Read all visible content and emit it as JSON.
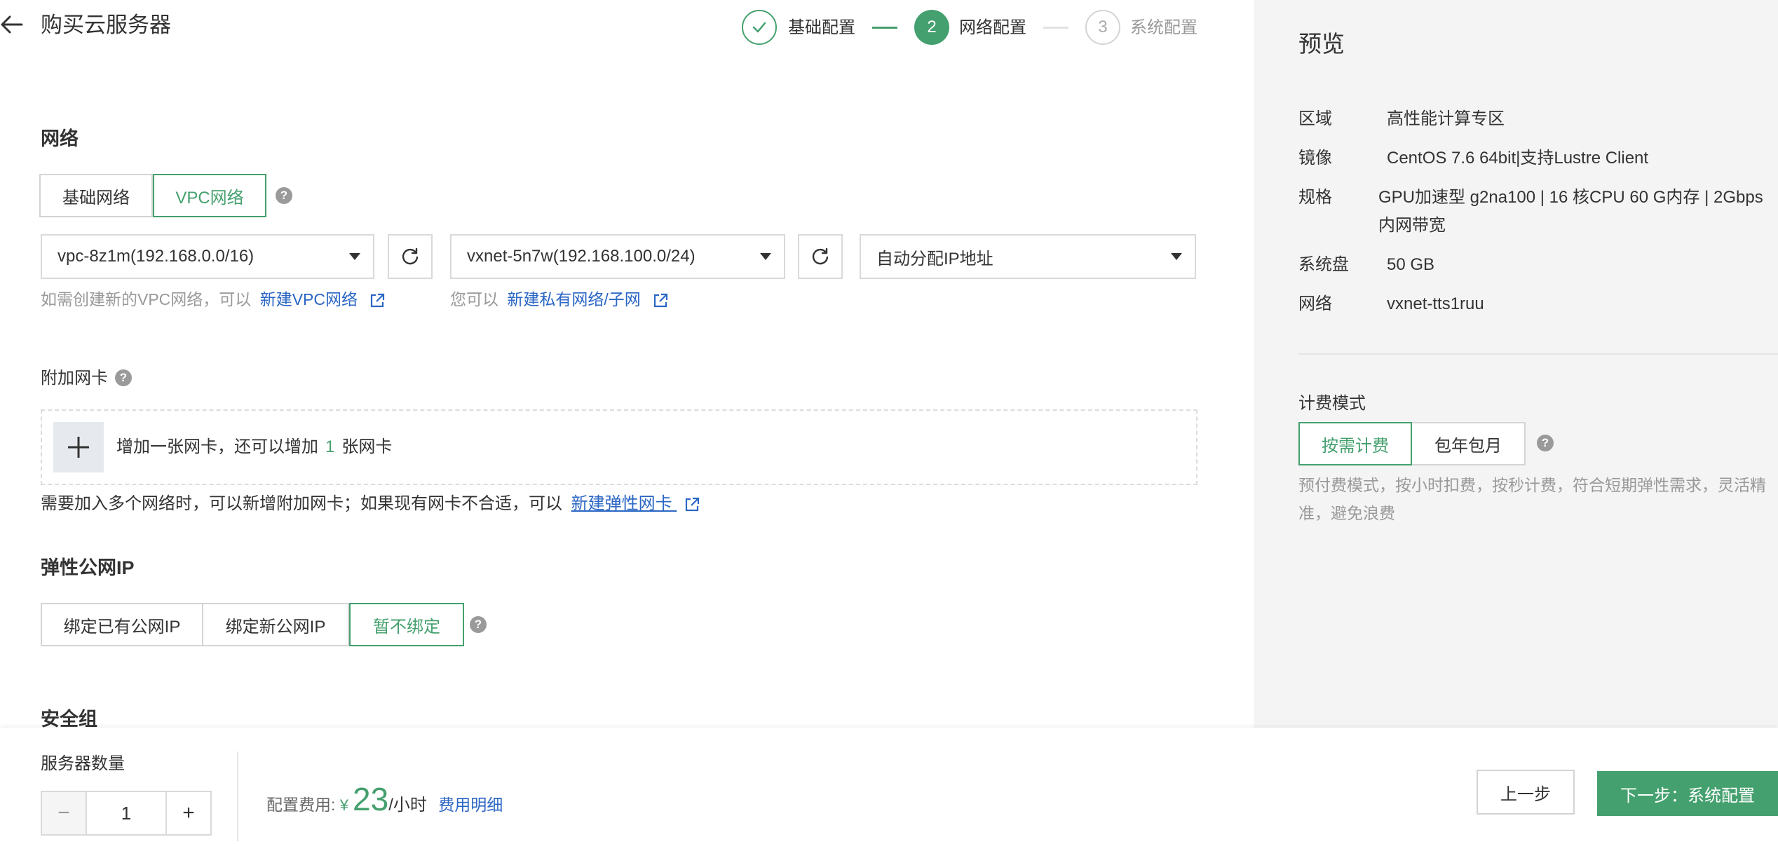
{
  "header": {
    "title": "购买云服务器",
    "steps": [
      {
        "number": "",
        "label": "基础配置",
        "state": "done"
      },
      {
        "number": "2",
        "label": "网络配置",
        "state": "active"
      },
      {
        "number": "3",
        "label": "系统配置",
        "state": "pending"
      }
    ]
  },
  "network": {
    "title": "网络",
    "tabs": [
      "基础网络",
      "VPC网络"
    ],
    "active_tab": "VPC网络",
    "vpc_select": "vpc-8z1m(192.168.0.0/16)",
    "vxnet_select": "vxnet-5n7w(192.168.100.0/24)",
    "ip_select": "自动分配IP地址",
    "vpc_hint": "如需创建新的VPC网络，可以",
    "vpc_link": "新建VPC网络",
    "vxnet_hint": "您可以",
    "vxnet_link": "新建私有网络/子网"
  },
  "nic": {
    "title": "附加网卡",
    "add_prefix": "增加一张网卡，还可以增加",
    "add_count": "1",
    "add_suffix": "张网卡",
    "note": "需要加入多个网络时，可以新增附加网卡；如果现有网卡不合适，可以",
    "note_link": "新建弹性网卡"
  },
  "eip": {
    "title": "弹性公网IP",
    "options": [
      "绑定已有公网IP",
      "绑定新公网IP",
      "暂不绑定"
    ],
    "active": "暂不绑定"
  },
  "security": {
    "title": "安全组"
  },
  "footer": {
    "qty_label": "服务器数量",
    "qty_value": "1",
    "minus": "−",
    "plus": "+",
    "cost_label": "配置费用:",
    "currency": "¥",
    "cost_amount": "23",
    "cost_unit": "/小时",
    "cost_detail": "费用明细",
    "prev": "上一步",
    "next": "下一步：系统配置"
  },
  "preview": {
    "title": "预览",
    "rows": [
      {
        "key": "区域",
        "value": "高性能计算专区"
      },
      {
        "key": "镜像",
        "value": "CentOS 7.6 64bit|支持Lustre Client"
      },
      {
        "key": "规格",
        "value": "GPU加速型 g2na100 | 16 核CPU 60 G内存 | 2Gbps 内网带宽"
      },
      {
        "key": "系统盘",
        "value": "50 GB"
      },
      {
        "key": "网络",
        "value": "vxnet-tts1ruu"
      }
    ],
    "billing_title": "计费模式",
    "billing_options": [
      "按需计费",
      "包年包月"
    ],
    "billing_active": "按需计费",
    "billing_desc": "预付费模式，按小时扣费，按秒计费，符合短期弹性需求，灵活精准，避免浪费"
  },
  "colors": {
    "accent": "#44a06e",
    "link": "#2a66c4",
    "muted": "#999999",
    "panel": "#f4f4f4"
  },
  "icons": [
    "back-arrow-icon",
    "check-icon",
    "help-icon",
    "caret-down-icon",
    "refresh-icon",
    "external-link-icon",
    "plus-icon"
  ]
}
